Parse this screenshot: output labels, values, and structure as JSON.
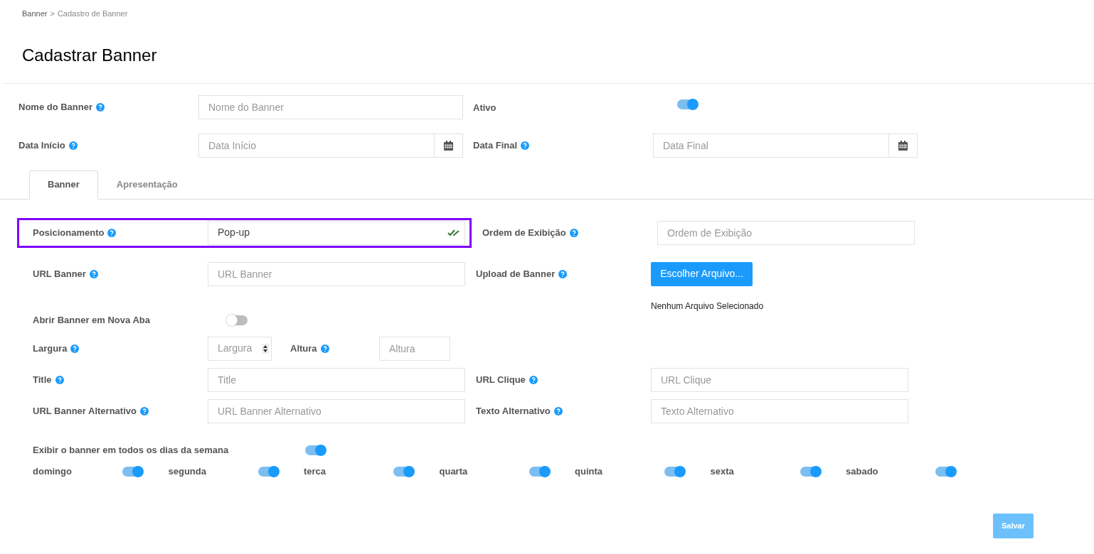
{
  "breadcrumb": {
    "items": [
      {
        "label": "Banner"
      },
      {
        "label": "Cadastro de Banner"
      }
    ],
    "separator": ">"
  },
  "title": "Cadastrar Banner",
  "header_rows": [
    [
      {
        "kind": "text",
        "label": "Nome do Banner",
        "help": true,
        "placeholder": "Nome do Banner"
      },
      {
        "kind": "toggle",
        "label": "Ativo",
        "help": false,
        "on": true
      }
    ],
    [
      {
        "kind": "date",
        "label": "Data Início",
        "help": true,
        "placeholder": "Data Início"
      },
      {
        "kind": "date",
        "label": "Data Final",
        "help": true,
        "placeholder": "Data Final"
      }
    ]
  ],
  "tabs": [
    {
      "label": "Banner",
      "selected": true
    },
    {
      "label": "Apresentação",
      "selected": false
    }
  ],
  "form_rows": [
    [
      {
        "kind": "select",
        "label": "Posicionamento",
        "help": true,
        "value": "Pop-up",
        "valid": true,
        "highlighted": true
      },
      {
        "kind": "text",
        "label": "Ordem de Exibição",
        "help": true,
        "placeholder": "Ordem de Exibição"
      }
    ],
    [
      {
        "kind": "text",
        "label": "URL Banner",
        "help": true,
        "placeholder": "URL Banner"
      },
      {
        "kind": "file",
        "label": "Upload de Banner",
        "help": true,
        "button_label": "Escolher Arquivo...",
        "file_status": "Nenhum Arquivo Selecionado"
      }
    ],
    [
      {
        "kind": "toggle",
        "label": "Abrir Banner em Nova Aba",
        "help": false,
        "on": false
      }
    ],
    [
      {
        "kind": "size",
        "label": "Largura",
        "help": true,
        "placeholder": "Largura",
        "second_label": "Altura",
        "second_help": true,
        "second_placeholder": "Altura"
      }
    ],
    [
      {
        "kind": "text",
        "label": "Title",
        "help": true,
        "placeholder": "Title"
      },
      {
        "kind": "text",
        "label": "URL Clique",
        "help": true,
        "placeholder": "URL Clique"
      }
    ],
    [
      {
        "kind": "text",
        "label": "URL Banner Alternativo",
        "help": true,
        "placeholder": "URL Banner Alternativo"
      },
      {
        "kind": "text",
        "label": "Texto Alternativo",
        "help": true,
        "placeholder": "Texto Alternativo"
      }
    ]
  ],
  "all_days": {
    "label": "Exibir o banner em todos os dias da semana",
    "on": true
  },
  "days": [
    {
      "label": "domingo",
      "on": true
    },
    {
      "label": "segunda",
      "on": true
    },
    {
      "label": "terca",
      "on": true
    },
    {
      "label": "quarta",
      "on": true
    },
    {
      "label": "quinta",
      "on": true
    },
    {
      "label": "sexta",
      "on": true
    },
    {
      "label": "sabado",
      "on": true
    }
  ],
  "save_button": "Salvar"
}
